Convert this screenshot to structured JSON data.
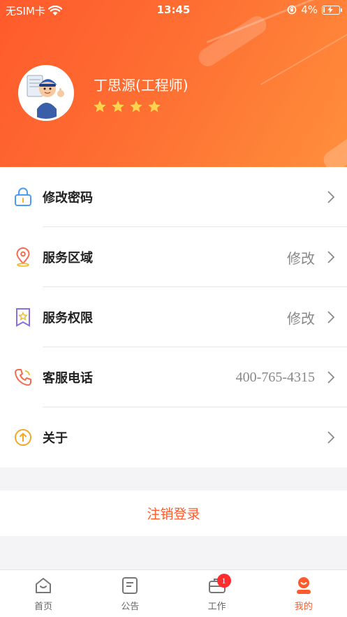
{
  "status_bar": {
    "carrier": "无SIM卡",
    "time": "13:45",
    "battery": "4%"
  },
  "profile": {
    "name": "丁思源(工程师)",
    "rating_stars": 4
  },
  "menu": [
    {
      "label": "修改密码",
      "value": "",
      "icon": "lock-icon"
    },
    {
      "label": "服务区域",
      "value": "修改",
      "icon": "location-pin-icon"
    },
    {
      "label": "服务权限",
      "value": "修改",
      "icon": "permission-badge-icon"
    },
    {
      "label": "客服电话",
      "value": "400-765-4315",
      "icon": "phone-icon"
    },
    {
      "label": "关于",
      "value": "",
      "icon": "info-up-icon"
    }
  ],
  "logout_label": "注销登录",
  "tabs": [
    {
      "label": "首页",
      "icon": "home-icon",
      "active": false
    },
    {
      "label": "公告",
      "icon": "notice-icon",
      "active": false
    },
    {
      "label": "工作",
      "icon": "briefcase-icon",
      "badge": "1",
      "active": false
    },
    {
      "label": "我的",
      "icon": "user-icon",
      "active": true
    }
  ],
  "colors": {
    "accent": "#ff5a2c",
    "header_light": "#ff8f3c",
    "badge": "#ff2d2d"
  }
}
